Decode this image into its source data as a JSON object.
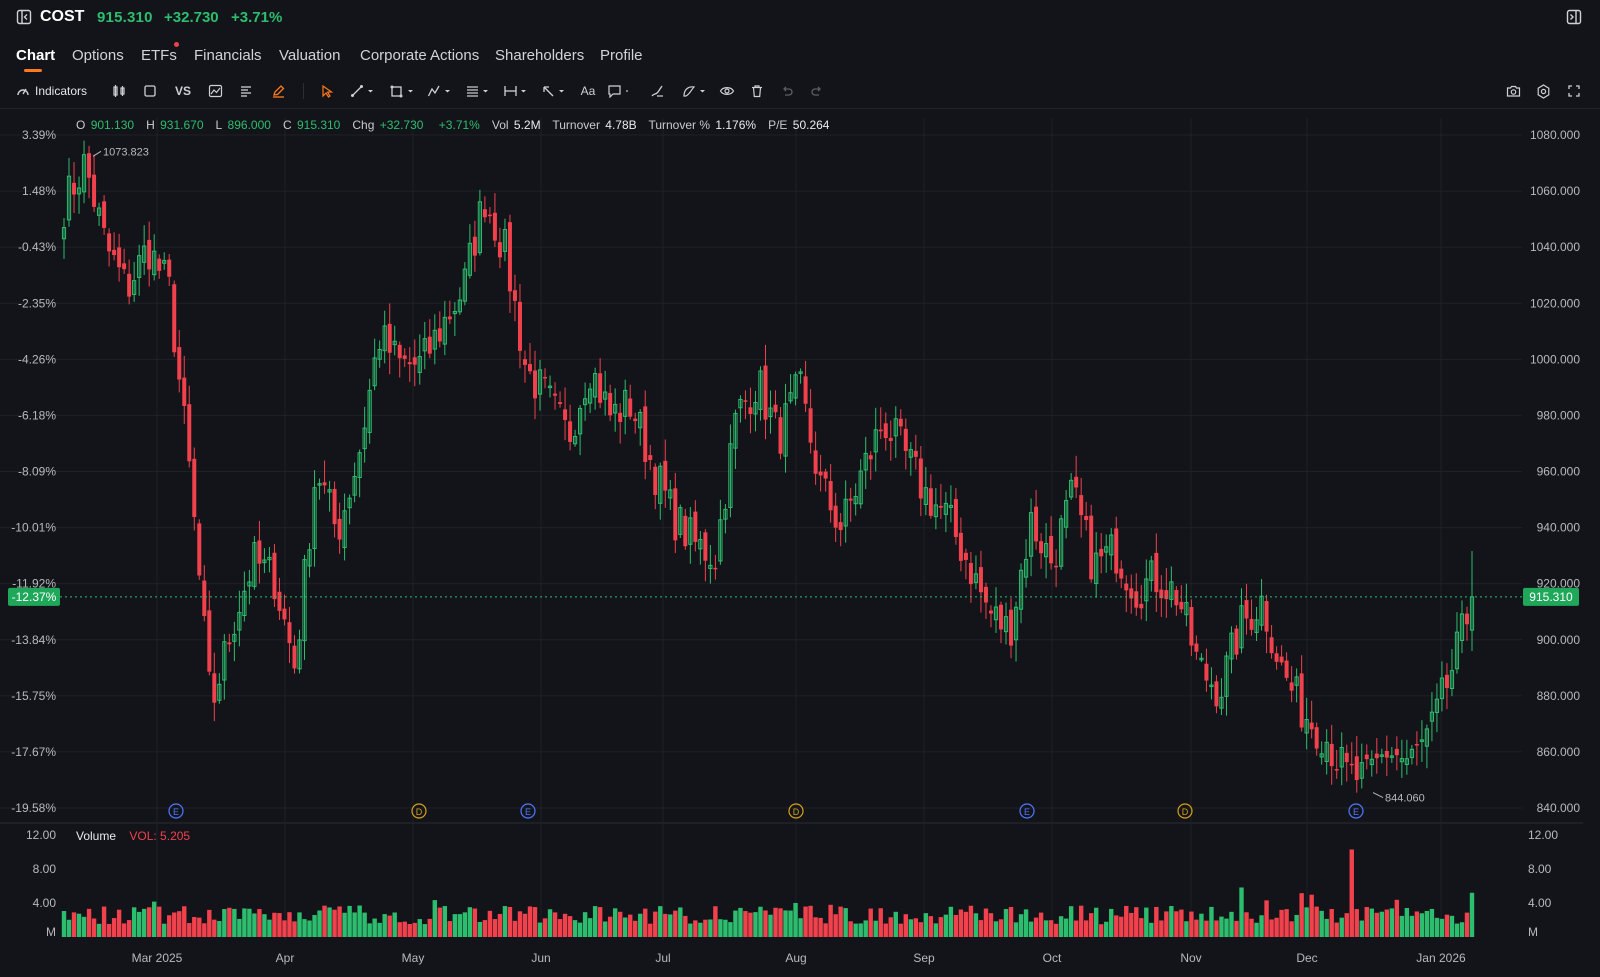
{
  "header": {
    "symbol": "COST",
    "price": "915.310",
    "change": "+32.730",
    "change_pct": "+3.71%"
  },
  "tabs": [
    "Chart",
    "Options",
    "ETFs",
    "Financials",
    "Valuation",
    "Corporate Actions",
    "Shareholders",
    "Profile"
  ],
  "toolbar": {
    "indicators_label": "Indicators",
    "vs_label": "VS",
    "text_label": "Aa"
  },
  "ohlc": {
    "o_label": "O",
    "o_value": "901.130",
    "h_label": "H",
    "h_value": "931.670",
    "l_label": "L",
    "l_value": "896.000",
    "c_label": "C",
    "c_value": "915.310",
    "chg_label": "Chg",
    "chg_value": "+32.730",
    "chg_pct": "+3.71%",
    "vol_label": "Vol",
    "vol_value": "5.2M",
    "turnover_label": "Turnover",
    "turnover_value": "4.78B",
    "turnover_pct_label": "Turnover %",
    "turnover_pct_value": "1.176%",
    "pe_label": "P/E",
    "pe_value": "50.264"
  },
  "volume_legend": {
    "name": "Volume",
    "value": "VOL: 5.205"
  },
  "colors": {
    "up": "#2dbd6e",
    "down": "#f0414c",
    "background": "#131419",
    "accent": "#ff7a1a"
  },
  "chart_data": {
    "type": "candlestick",
    "price_axis": {
      "ticks": [
        1080,
        1060,
        1040,
        1020,
        1000,
        980,
        960,
        940,
        920,
        900,
        880,
        860,
        840
      ],
      "tick_labels": [
        "1080.000",
        "1060.000",
        "1040.000",
        "1020.000",
        "1000.000",
        "980.000",
        "960.000",
        "940.000",
        "920.000",
        "900.000",
        "880.000",
        "860.000",
        "840.000"
      ],
      "range": [
        840,
        1080
      ]
    },
    "pct_axis": {
      "tick_labels": [
        "3.39%",
        "1.48%",
        "-0.43%",
        "-2.35%",
        "-4.26%",
        "-6.18%",
        "-8.09%",
        "-10.01%",
        "-11.92%",
        "-13.84%",
        "-15.75%",
        "-17.67%",
        "-19.58%"
      ]
    },
    "x_axis": {
      "labels": [
        "Mar 2025",
        "Apr",
        "May",
        "Jun",
        "Jul",
        "Aug",
        "Sep",
        "Oct",
        "Nov",
        "Dec",
        "Jan 2026"
      ]
    },
    "last_price": 915.31,
    "last_price_label": "915.310",
    "last_pct_label": "-12.37%",
    "high_marker": {
      "value": 1073.823,
      "label": "1073.823"
    },
    "low_marker": {
      "value": 844.06,
      "label": "844.060"
    },
    "events": [
      "E",
      "D",
      "E",
      "D",
      "E",
      "D",
      "E"
    ],
    "volume_axis": {
      "tick_labels": [
        "12.00",
        "8.00",
        "4.00",
        "M"
      ],
      "range": [
        0,
        12
      ],
      "unit": "M"
    },
    "anchors": [
      [
        1010,
        1055
      ],
      [
        1073.8,
        1070
      ],
      [
        1052,
        1040
      ],
      [
        1030,
        1025
      ],
      [
        1045,
        1040
      ],
      [
        1030,
        1025
      ],
      [
        966,
        958
      ],
      [
        875,
        875
      ],
      [
        910,
        905
      ],
      [
        932,
        928
      ],
      [
        925,
        922
      ],
      [
        890,
        890
      ],
      [
        965,
        962
      ],
      [
        940,
        938
      ],
      [
        968,
        965
      ],
      [
        1010,
        1008
      ],
      [
        1000,
        998
      ],
      [
        1003,
        998
      ],
      [
        1015,
        1012
      ],
      [
        1030,
        1025
      ],
      [
        1062,
        1058
      ],
      [
        1040,
        1038
      ],
      [
        1000,
        996
      ],
      [
        990,
        986
      ],
      [
        975,
        972
      ],
      [
        1000,
        998
      ],
      [
        982,
        980
      ],
      [
        987,
        984
      ],
      [
        965,
        962
      ],
      [
        945,
        944
      ],
      [
        938,
        934
      ],
      [
        931,
        930
      ],
      [
        982,
        980
      ],
      [
        996,
        992
      ],
      [
        974,
        972
      ],
      [
        992,
        990
      ],
      [
        958,
        955
      ],
      [
        942,
        940
      ],
      [
        962,
        960
      ],
      [
        980,
        978
      ],
      [
        970,
        966
      ],
      [
        956,
        952
      ],
      [
        945,
        944
      ],
      [
        930,
        928
      ],
      [
        912,
        910
      ],
      [
        905,
        903
      ],
      [
        945,
        942
      ],
      [
        932,
        928
      ],
      [
        955,
        952
      ],
      [
        930,
        926
      ],
      [
        935,
        932
      ],
      [
        919,
        918
      ],
      [
        925,
        922
      ],
      [
        916,
        916
      ],
      [
        890,
        890
      ],
      [
        884,
        882
      ],
      [
        908,
        905
      ],
      [
        916,
        914
      ],
      [
        888,
        888
      ],
      [
        875,
        874
      ],
      [
        868,
        866
      ],
      [
        852,
        852
      ],
      [
        844.06,
        850
      ],
      [
        862,
        861
      ],
      [
        858,
        856
      ],
      [
        868,
        866
      ],
      [
        889,
        888
      ],
      [
        915.31,
        914
      ]
    ]
  }
}
